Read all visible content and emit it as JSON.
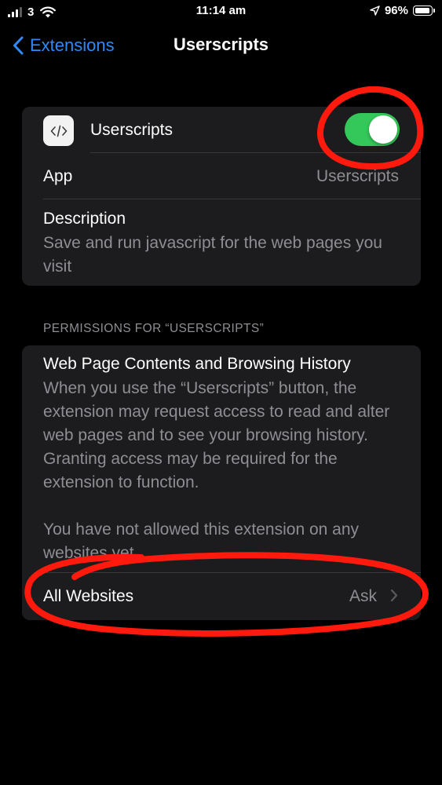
{
  "status_bar": {
    "carrier": "3",
    "time": "11:14 am",
    "battery": "96%",
    "battery_level": 0.96,
    "icons": [
      "signal-icon",
      "wifi-icon",
      "location-arrow-icon",
      "battery-icon"
    ]
  },
  "nav": {
    "back_label": "Extensions",
    "title": "Userscripts",
    "back_icon": "chevron-left-icon"
  },
  "extension": {
    "name": "Userscripts",
    "icon": "code-brackets-icon",
    "enabled": true,
    "app_label": "App",
    "app_value": "Userscripts",
    "description_label": "Description",
    "description_text": "Save and run javascript for the web pages you visit"
  },
  "permissions": {
    "section_header": "PERMISSIONS FOR “USERSCRIPTS”",
    "title": "Web Page Contents and Browsing History",
    "body": "When you use the “Userscripts” button, the extension may request access to read and alter web pages and to see your browsing history. Granting access may be required for the extension to function.",
    "note": "You have not allowed this extension on any websites yet.",
    "all_websites_label": "All Websites",
    "all_websites_value": "Ask"
  },
  "colors": {
    "accent": "#2f8af5",
    "toggle_on": "#34c759",
    "annotation": "#ff1a0d",
    "card_bg": "#1c1c1e",
    "secondary_text": "#8e8e93"
  }
}
